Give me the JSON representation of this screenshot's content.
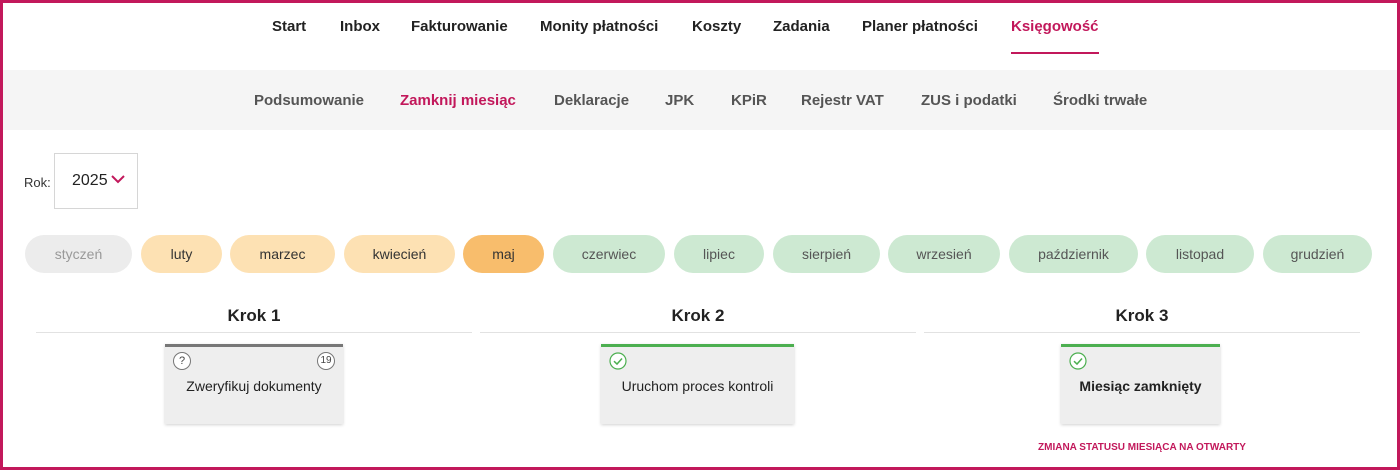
{
  "top_nav": {
    "items": [
      {
        "label": "Start"
      },
      {
        "label": "Inbox"
      },
      {
        "label": "Fakturowanie"
      },
      {
        "label": "Monity płatności"
      },
      {
        "label": "Koszty"
      },
      {
        "label": "Zadania"
      },
      {
        "label": "Planer płatności"
      },
      {
        "label": "Księgowość"
      }
    ],
    "active": "Księgowość"
  },
  "sub_nav": {
    "items": [
      {
        "label": "Podsumowanie"
      },
      {
        "label": "Zamknij miesiąc"
      },
      {
        "label": "Deklaracje"
      },
      {
        "label": "JPK"
      },
      {
        "label": "KPiR"
      },
      {
        "label": "Rejestr VAT"
      },
      {
        "label": "ZUS i podatki"
      },
      {
        "label": "Środki trwałe"
      }
    ],
    "active": "Zamknij miesiąc"
  },
  "year": {
    "label": "Rok:",
    "value": "2025"
  },
  "months": [
    {
      "label": "styczeń",
      "status": "inactive"
    },
    {
      "label": "luty",
      "status": "open"
    },
    {
      "label": "marzec",
      "status": "open"
    },
    {
      "label": "kwiecień",
      "status": "open"
    },
    {
      "label": "maj",
      "status": "selected"
    },
    {
      "label": "czerwiec",
      "status": "closed"
    },
    {
      "label": "lipiec",
      "status": "closed"
    },
    {
      "label": "sierpień",
      "status": "closed"
    },
    {
      "label": "wrzesień",
      "status": "closed"
    },
    {
      "label": "październik",
      "status": "closed"
    },
    {
      "label": "listopad",
      "status": "closed"
    },
    {
      "label": "grudzień",
      "status": "closed"
    }
  ],
  "steps": [
    {
      "title": "Krok 1",
      "card_text": "Zweryfikuj dokumenty",
      "help_icon": "?",
      "badge_count": "19",
      "status": "pending"
    },
    {
      "title": "Krok 2",
      "card_text": "Uruchom proces kontroli",
      "status": "done"
    },
    {
      "title": "Krok 3",
      "card_text": "Miesiąc zamknięty",
      "status": "done"
    }
  ],
  "status_change_link": "ZMIANA STATUSU MIESIĄCA NA OTWARTY",
  "colors": {
    "accent": "#c2185b",
    "success": "#4caf50",
    "month_open": "#fde1b3",
    "month_selected": "#f8bd6c",
    "month_closed": "#cde9d2",
    "month_inactive": "#ececec"
  }
}
